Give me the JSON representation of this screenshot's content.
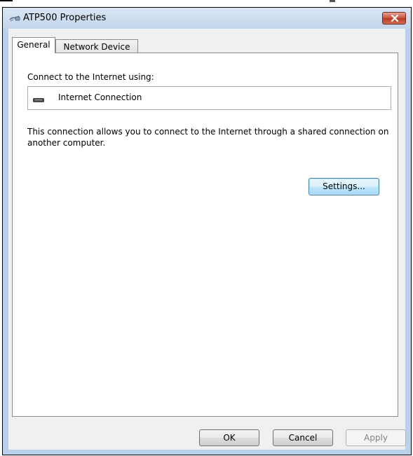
{
  "window": {
    "title": "ATP500 Properties"
  },
  "tabs": [
    {
      "label": "General",
      "active": true
    },
    {
      "label": "Network Device",
      "active": false
    }
  ],
  "general": {
    "connect_label": "Connect to the Internet using:",
    "connection_name": "Internet Connection",
    "connection_icon": "network-adapter-icon",
    "description": "This connection allows you to connect to the Internet through a shared connection on another computer.",
    "settings_label": "Settings..."
  },
  "footer": {
    "ok_label": "OK",
    "cancel_label": "Cancel",
    "apply_label": "Apply"
  },
  "colors": {
    "close_button": "#c6503c",
    "focus_border": "#3c7fb1",
    "disabled_text": "#838383"
  }
}
